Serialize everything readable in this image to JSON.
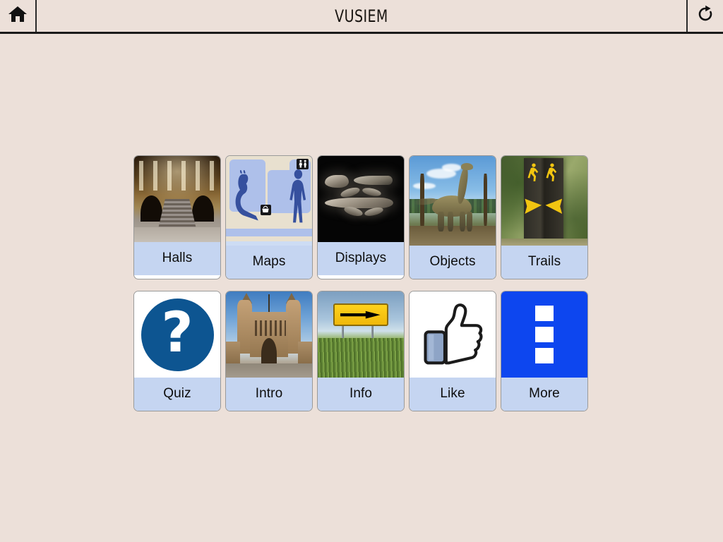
{
  "header": {
    "title": "VUSIEM",
    "home_icon": "home-icon",
    "refresh_icon": "refresh-icon",
    "background_color": "#ece0d9",
    "border_color": "#1a1a1a"
  },
  "theme": {
    "page_background": "#ece0d9",
    "tile_label_background": "#c5d5f1",
    "tile_border": "#9a9a9a",
    "more_tile_blue": "#0d46ef",
    "quiz_circle_blue": "#0d5591",
    "trail_yellow": "#f2c511",
    "sign_yellow": "#ffd21c"
  },
  "grid": {
    "rows": [
      {
        "tiles": [
          {
            "label": "Halls",
            "art": "museum-hall-interior"
          },
          {
            "label": "Maps",
            "art": "floor-plan-map"
          },
          {
            "label": "Displays",
            "art": "fossil-display-black"
          },
          {
            "label": "Objects",
            "art": "sauropod-dinosaur"
          },
          {
            "label": "Trails",
            "art": "trail-waymarker-post"
          }
        ]
      },
      {
        "tiles": [
          {
            "label": "Quiz",
            "art": "question-mark-circle"
          },
          {
            "label": "Intro",
            "art": "museum-facade"
          },
          {
            "label": "Info",
            "art": "yellow-arrow-road-sign"
          },
          {
            "label": "Like",
            "art": "thumbs-up"
          },
          {
            "label": "More",
            "art": "vertical-kebab-menu"
          }
        ]
      }
    ]
  }
}
